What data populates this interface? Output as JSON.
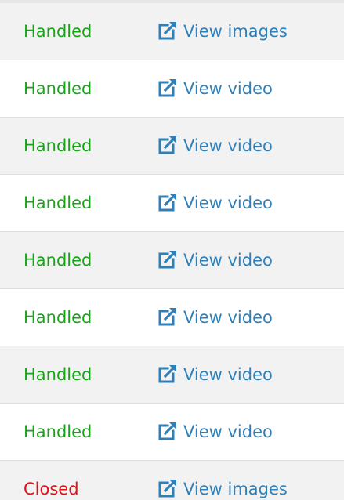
{
  "colors": {
    "handled": "#1aa31a",
    "closed": "#e0111d",
    "link": "#2f7fb8",
    "row_alt": "#f2f2f2"
  },
  "rows": [
    {
      "status": "Handled",
      "status_type": "handled",
      "link_label": "View images",
      "link_icon": "external-link-icon"
    },
    {
      "status": "Handled",
      "status_type": "handled",
      "link_label": "View video",
      "link_icon": "external-link-icon"
    },
    {
      "status": "Handled",
      "status_type": "handled",
      "link_label": "View video",
      "link_icon": "external-link-icon"
    },
    {
      "status": "Handled",
      "status_type": "handled",
      "link_label": "View video",
      "link_icon": "external-link-icon"
    },
    {
      "status": "Handled",
      "status_type": "handled",
      "link_label": "View video",
      "link_icon": "external-link-icon"
    },
    {
      "status": "Handled",
      "status_type": "handled",
      "link_label": "View video",
      "link_icon": "external-link-icon"
    },
    {
      "status": "Handled",
      "status_type": "handled",
      "link_label": "View video",
      "link_icon": "external-link-icon"
    },
    {
      "status": "Handled",
      "status_type": "handled",
      "link_label": "View video",
      "link_icon": "external-link-icon"
    },
    {
      "status": "Closed",
      "status_type": "closed",
      "link_label": "View images",
      "link_icon": "external-link-icon"
    }
  ]
}
